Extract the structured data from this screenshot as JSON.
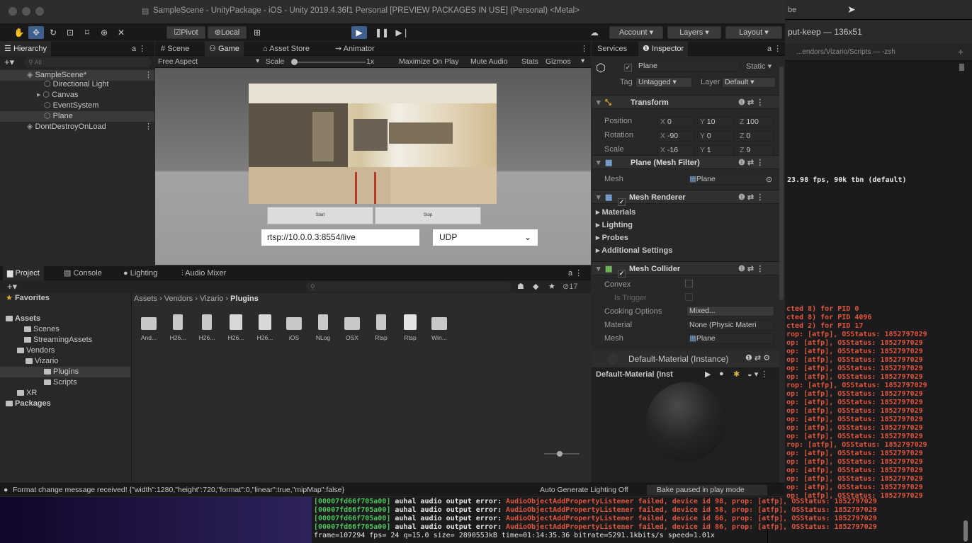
{
  "terminal": {
    "title_fragment": "be",
    "tab1": "put-keep — 136x51",
    "tab2": "...endors/Vizario/Scripts — -zsh",
    "fps_line": "23.98 fps, 90k tbn (default)",
    "pid_lines": [
      "cted 8) for PID 0",
      "cted 8) for PID 4096",
      "cted 2) for PID 17"
    ],
    "prop_lines": [
      "rop: [atfp], OSStatus: 1852797029",
      "op: [atfp], OSStatus: 1852797029",
      "op: [atfp], OSStatus: 1852797029",
      "op: [atfp], OSStatus: 1852797029",
      "op: [atfp], OSStatus: 1852797029",
      "op: [atfp], OSStatus: 1852797029",
      "rop: [atfp], OSStatus: 1852797029",
      "op: [atfp], OSStatus: 1852797029",
      "op: [atfp], OSStatus: 1852797029",
      "op: [atfp], OSStatus: 1852797029",
      "op: [atfp], OSStatus: 1852797029",
      "op: [atfp], OSStatus: 1852797029",
      "op: [atfp], OSStatus: 1852797029",
      "rop: [atfp], OSStatus: 1852797029",
      "op: [atfp], OSStatus: 1852797029",
      "op: [atfp], OSStatus: 1852797029",
      "op: [atfp], OSStatus: 1852797029",
      "op: [atfp], OSStatus: 1852797029",
      "op: [atfp], OSStatus: 1852797029",
      "op: [atfp], OSStatus: 1852797029"
    ],
    "console_lines": [
      {
        "addr": "[00007fd66f705a00]",
        "msg": " auhal audio output error: ",
        "err": "AudioObjectAddPropertyListener failed, device id 98, ",
        "tail": "prop: [atfp], OSStatus: 1852797029"
      },
      {
        "addr": "[00007fd66f705a00]",
        "msg": " auhal audio output error: ",
        "err": "AudioObjectAddPropertyListener failed, device id 58, ",
        "tail": "prop: [atfp], OSStatus: 1852797029"
      },
      {
        "addr": "[00007fd66f705a00]",
        "msg": " auhal audio output error: ",
        "err": "AudioObjectAddPropertyListener failed, device id 66, ",
        "tail": "prop: [atfp], OSStatus: 1852797029"
      },
      {
        "addr": "[00007fd66f705a00]",
        "msg": " auhal audio output error: ",
        "err": "AudioObjectAddPropertyListener failed, device id 86, ",
        "tail": "prop: [atfp], OSStatus: 1852797029"
      }
    ],
    "frame_line": "frame=107294 fps= 24 q=15.0 size= 2890553kB time=01:14:35.36 bitrate=5291.1kbits/s speed=1.01x"
  },
  "window": {
    "title": "SampleScene - UnityPackage - iOS - Unity 2019.4.36f1 Personal [PREVIEW PACKAGES IN USE] (Personal) <Metal>"
  },
  "toolbar": {
    "pivot": "Pivot",
    "local": "Local",
    "account": "Account",
    "layers": "Layers",
    "layout": "Layout"
  },
  "hierarchy": {
    "tab": "Hierarchy",
    "search_placeholder": "All",
    "items": [
      "SampleScene*",
      "Directional Light",
      "Canvas",
      "EventSystem",
      "Plane",
      "DontDestroyOnLoad"
    ]
  },
  "center_tabs": [
    "Scene",
    "Game",
    "Asset Store",
    "Animator"
  ],
  "game": {
    "aspect": "Free Aspect",
    "scale_label": "Scale",
    "scale_value": "1x",
    "maximize": "Maximize On Play",
    "mute": "Mute Audio",
    "stats": "Stats",
    "gizmos": "Gizmos",
    "start_btn": "Start",
    "stop_btn": "Stop",
    "url": "rtsp://10.0.0.3:8554/live",
    "protocol": "UDP"
  },
  "project": {
    "tabs": [
      "Project",
      "Console",
      "Lighting",
      "Audio Mixer"
    ],
    "hidden_count": "17",
    "favorites": "Favorites",
    "tree": [
      "Assets",
      "Scenes",
      "StreamingAssets",
      "Vendors",
      "Vizario",
      "Plugins",
      "Scripts",
      "XR",
      "Packages"
    ],
    "breadcrumb": [
      "Assets",
      "Vendors",
      "Vizario",
      "Plugins"
    ],
    "assets": [
      "And...",
      "H26...",
      "H26...",
      "H26...",
      "H26...",
      "iOS",
      "NLog",
      "OSX",
      "Rtsp",
      "Rtsp",
      "Win..."
    ]
  },
  "inspector": {
    "tabs": [
      "Services",
      "Inspector"
    ],
    "object_name": "Plane",
    "static": "Static",
    "tag_label": "Tag",
    "tag_value": "Untagged",
    "layer_label": "Layer",
    "layer_value": "Default",
    "transform": "Transform",
    "position_label": "Position",
    "position": [
      "0",
      "10",
      "100"
    ],
    "rotation_label": "Rotation",
    "rotation": [
      "-90",
      "0",
      "0"
    ],
    "scale_label": "Scale",
    "scale": [
      "-16",
      "1",
      "9"
    ],
    "mesh_filter": "Plane (Mesh Filter)",
    "mesh_label": "Mesh",
    "mesh_value": "Plane",
    "mesh_renderer": "Mesh Renderer",
    "renderer_sections": [
      "Materials",
      "Lighting",
      "Probes",
      "Additional Settings"
    ],
    "mesh_collider": "Mesh Collider",
    "convex": "Convex",
    "is_trigger": "Is Trigger",
    "cooking_label": "Cooking Options",
    "cooking_value": "Mixed...",
    "material_label": "Material",
    "material_value": "None (Physic Materi",
    "collider_mesh_label": "Mesh",
    "collider_mesh_value": "Plane",
    "material_header": "Default-Material (Instance)",
    "preview_title": "Default-Material (Inst"
  },
  "status": {
    "message": "Format change message received! {\"width\":1280,\"height\":720,\"format\":0,\"linear\":true,\"mipMap\":false}",
    "auto_lighting": "Auto Generate Lighting Off",
    "bake": "Bake paused in play mode"
  }
}
